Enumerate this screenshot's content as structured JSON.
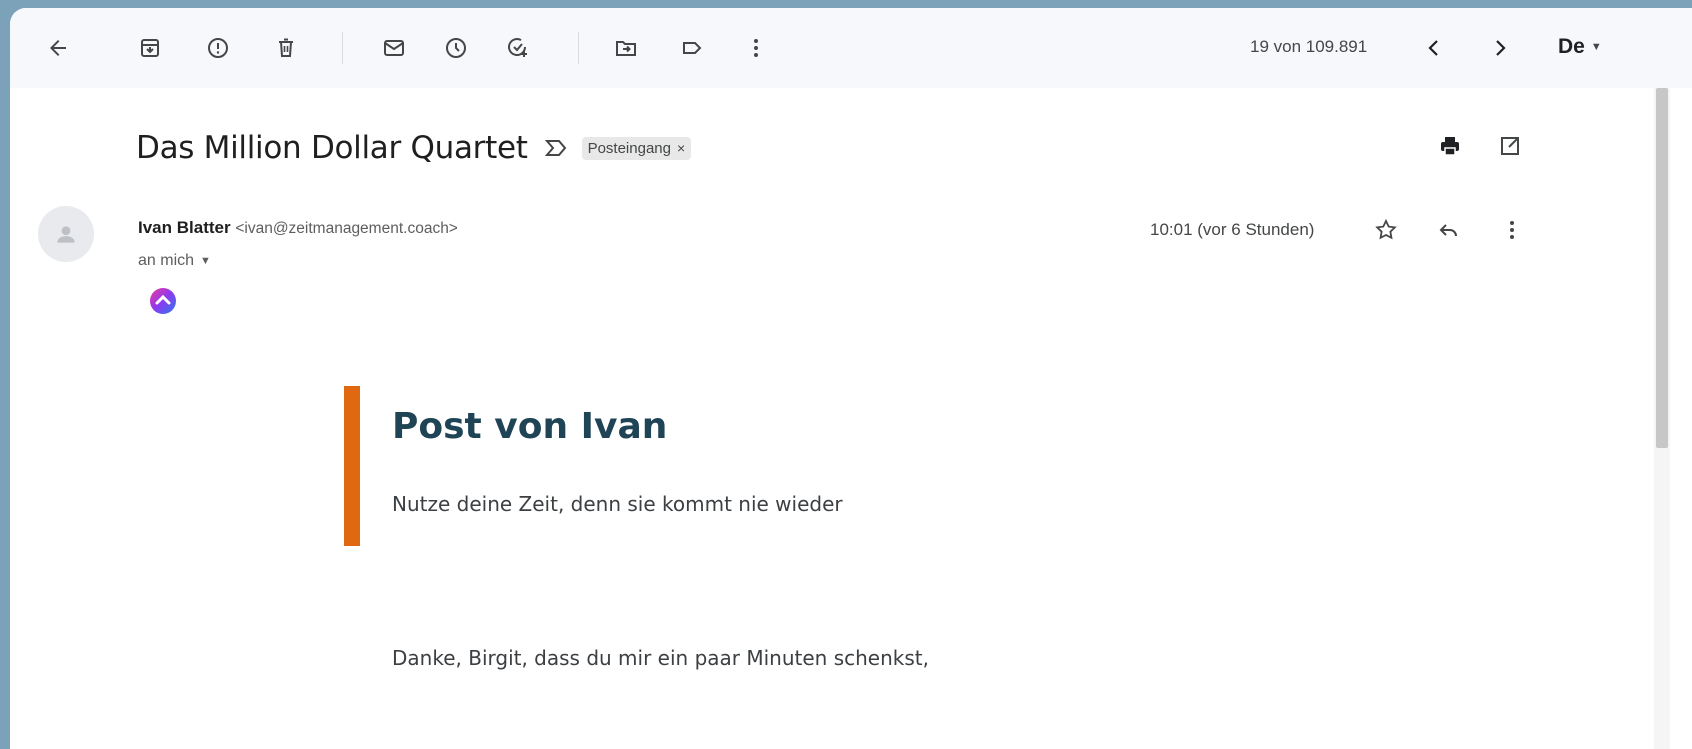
{
  "toolbar": {
    "count": "19 von 109.891",
    "lang": "De",
    "icons": [
      "back-arrow-icon",
      "archive-icon",
      "report-spam-icon",
      "delete-icon",
      "mark-unread-icon",
      "snooze-icon",
      "add-task-icon",
      "move-to-icon",
      "label-icon",
      "more-vert-icon",
      "prev-icon",
      "next-icon"
    ]
  },
  "email": {
    "subject": "Das Million Dollar Quartet",
    "label": "Posteingang",
    "label_close": "×",
    "sender_name": "Ivan Blatter",
    "sender_email": "<ivan@zeitmanagement.coach>",
    "recipient": "an mich",
    "time": "10:01 (vor 6 Stunden)"
  },
  "content": {
    "title": "Post von Ivan",
    "subtitle": "Nutze deine Zeit, denn sie kommt nie wieder",
    "body_line": "Danke, Birgit, dass du mir ein paar Minuten schenkst,"
  },
  "colors": {
    "accent_bar": "#e0690f",
    "title_color": "#1e4456",
    "toolbar_bg": "#f6f8fc",
    "page_bg": "#7ba2b8"
  }
}
